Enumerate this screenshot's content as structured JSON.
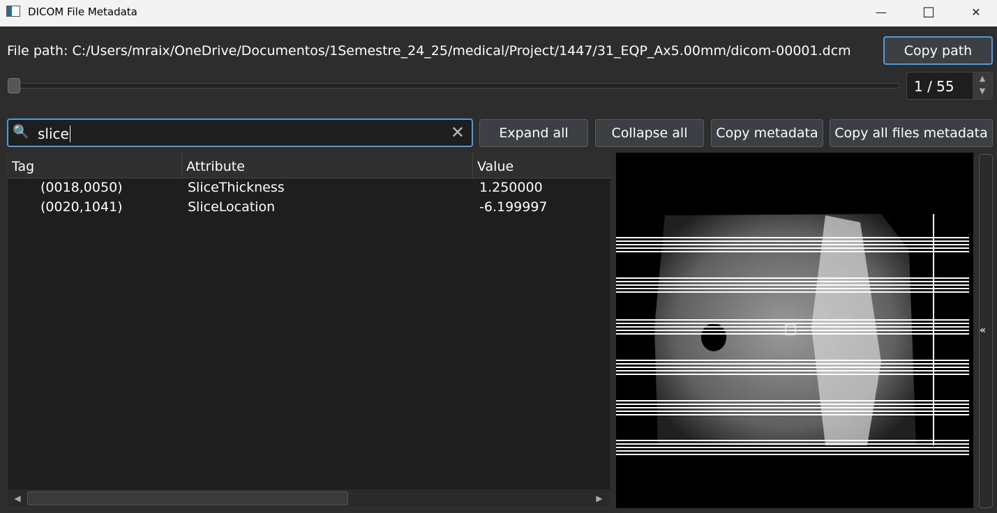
{
  "window": {
    "title": "DICOM File Metadata",
    "minimize": "—",
    "maximize": "☐",
    "close": "✕"
  },
  "file": {
    "label": "File path: C:/Users/mraix/OneDrive/Documentos/1Semestre_24_25/medical/Project/1447/31_EQP_Ax5.00mm/dicom-00001.dcm",
    "copy_button": "Copy path"
  },
  "slider": {
    "value": 1,
    "max": 55,
    "display": "1 / 55"
  },
  "search": {
    "icon": "search-icon",
    "value": "slice",
    "clear": "✕"
  },
  "toolbar": {
    "expand": "Expand all",
    "collapse": "Collapse all",
    "copy_metadata": "Copy metadata",
    "copy_all": "Copy all files metadata"
  },
  "table": {
    "headers": [
      "Tag",
      "Attribute",
      "Value"
    ],
    "rows": [
      {
        "tag": "(0018,0050)",
        "attribute": "SliceThickness",
        "value": "1.250000"
      },
      {
        "tag": "(0020,1041)",
        "attribute": "SliceLocation",
        "value": "-6.199997"
      }
    ]
  },
  "side_toggle": "«"
}
